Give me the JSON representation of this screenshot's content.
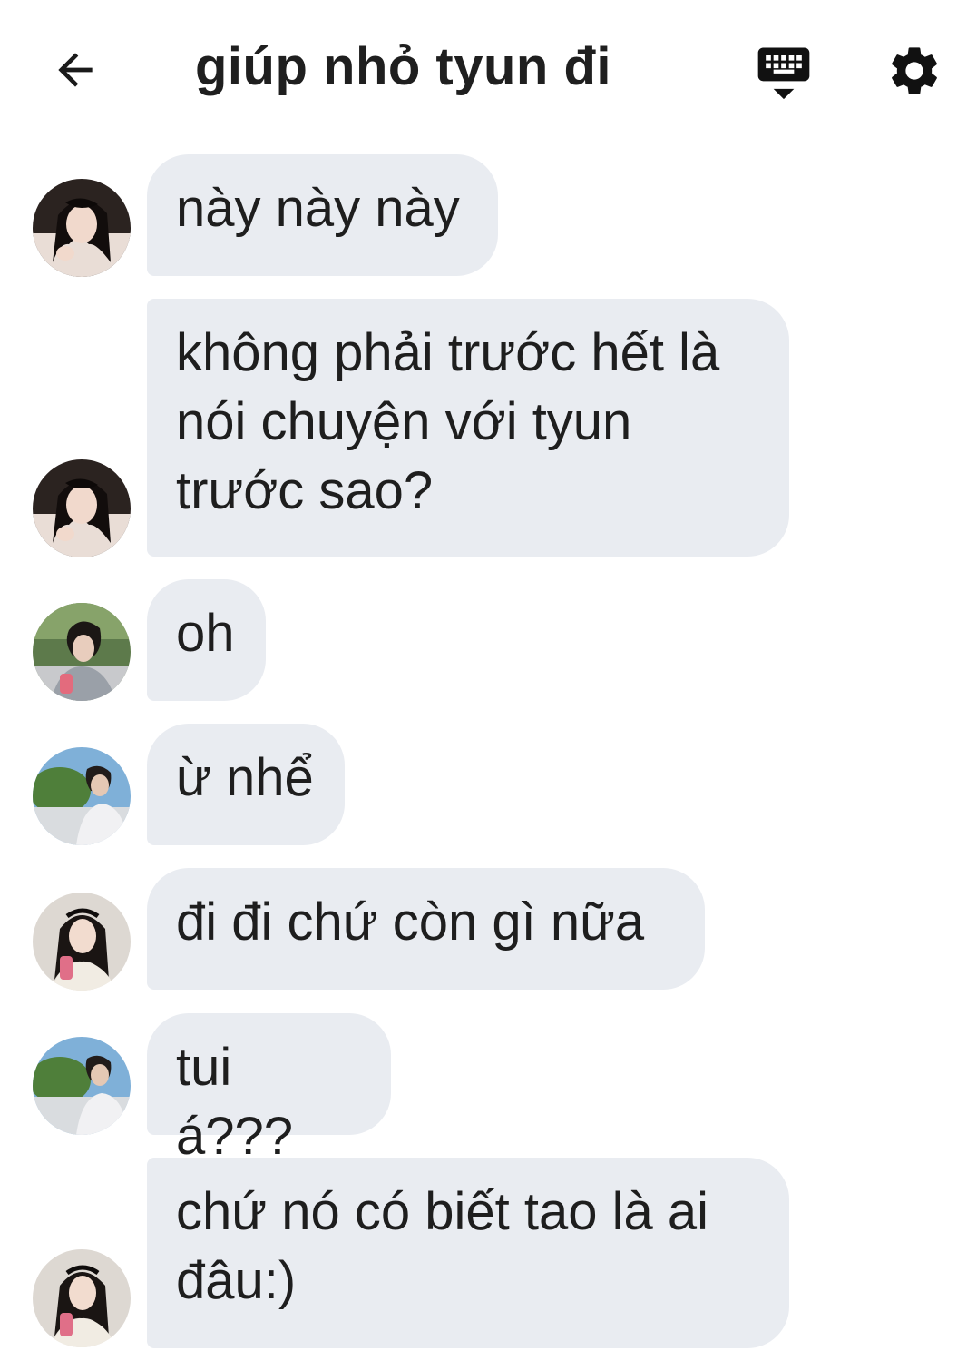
{
  "header": {
    "title": "giúp nhỏ tyun đi",
    "back_icon": "arrow-left-icon",
    "keyboard_icon": "keyboard-hide-icon",
    "settings_icon": "gear-icon"
  },
  "messages": [
    {
      "text": "này này này",
      "avatar": "avatar-a"
    },
    {
      "text": "không phải trước hết là nói chuyện với tyun trước sao?",
      "avatar": "avatar-a"
    },
    {
      "text": "oh",
      "avatar": "avatar-b"
    },
    {
      "text": "ừ nhể",
      "avatar": "avatar-c"
    },
    {
      "text": "đi đi chứ còn gì nữa",
      "avatar": "avatar-d"
    },
    {
      "text": "tui á???",
      "avatar": "avatar-c"
    },
    {
      "text": "chứ nó có biết tao là ai đâu:)",
      "avatar": "avatar-d"
    }
  ],
  "colors": {
    "bubble": "#e9ecf1",
    "text": "#1e1e1e",
    "background": "#ffffff"
  }
}
